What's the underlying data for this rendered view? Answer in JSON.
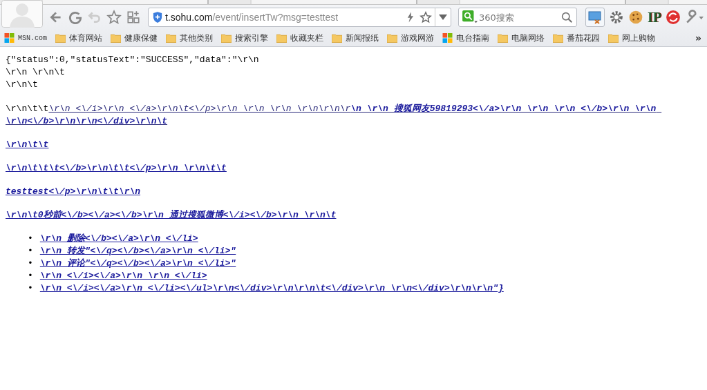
{
  "toolbar": {
    "address_host": "t.sohu.com",
    "address_path": "/event/insertTw?msg=testtest",
    "search": {
      "placeholder": "360搜索"
    },
    "ip_button": "IP"
  },
  "bookmarks": [
    {
      "kind": "msn",
      "label": "MSN.com"
    },
    {
      "kind": "folder",
      "label": "体育网站"
    },
    {
      "kind": "folder",
      "label": "健康保健"
    },
    {
      "kind": "folder",
      "label": "其他类别"
    },
    {
      "kind": "folder",
      "label": "搜索引擎"
    },
    {
      "kind": "folder",
      "label": "收藏夹栏"
    },
    {
      "kind": "folder",
      "label": "新闻报纸"
    },
    {
      "kind": "folder",
      "label": "游戏网游"
    },
    {
      "kind": "windows",
      "label": "电台指南"
    },
    {
      "kind": "folder",
      "label": "电脑网络"
    },
    {
      "kind": "folder",
      "label": "番茄花园"
    },
    {
      "kind": "folder",
      "label": "网上购物"
    }
  ],
  "bookmarks_more": "»",
  "content": {
    "plain_lines": [
      "{\"status\":0,\"statusText\":\"SUCCESS\",\"data\":\"\\r\\n",
      "\\r\\n \\r\\n\\t",
      "\\r\\n\\t"
    ],
    "mixed_prefix": "\\r\\n\\t\\t",
    "mixed_link": "\\r\\n <\\/i>\\r\\n <\\/a>\\r\\n\\t<\\/p>\\r\\n \\r\\n \\r\\n \\r\\n\\r\\n\\r**\\n \\r\\n 搜狐网友59819293<\\/a>\\r\\n \\r\\n \\r\\n <\\/b>\\r\\n \\r\\n \\r\\n<\\/b>\\r\\n\\r\\n<\\/div>\\r\\n\\t**",
    "links": [
      "\\r\\n\\t\\t",
      "\\r\\n\\t\\t\\t<\\/b>\\r\\n\\t\\t<\\/p>\\r\\n \\r\\n\\t\\t",
      "testtest<\\/p>\\r\\n\\t\\t\\r\\n",
      "\\r\\n\\t0秒前<\\/b><\\/a><\\/b>\\r\\n 通过搜狐微博<\\/i><\\/b>\\r\\n \\r\\n\\t"
    ],
    "list_marker": "•",
    "list_items": [
      "\\r\\n 删除<\\/b><\\/a>\\r\\n <\\/li>",
      "\\r\\n 转发\"<\\/q><\\/b><\\/a>\\r\\n <\\/li>\"",
      "\\r\\n 评论\"<\\/q><\\/b><\\/a>\\r\\n <\\/li>\"",
      "\\r\\n <\\/i><\\/a>\\r\\n \\r\\n <\\/li>",
      "\\r\\n <\\/i><\\/a>\\r\\n <\\/li><\\/ul>\\r\\n<\\/div>\\r\\n\\r\\n\\t<\\/div>\\r\\n \\r\\n<\\/div>\\r\\n\\r\\n\"}"
    ]
  }
}
